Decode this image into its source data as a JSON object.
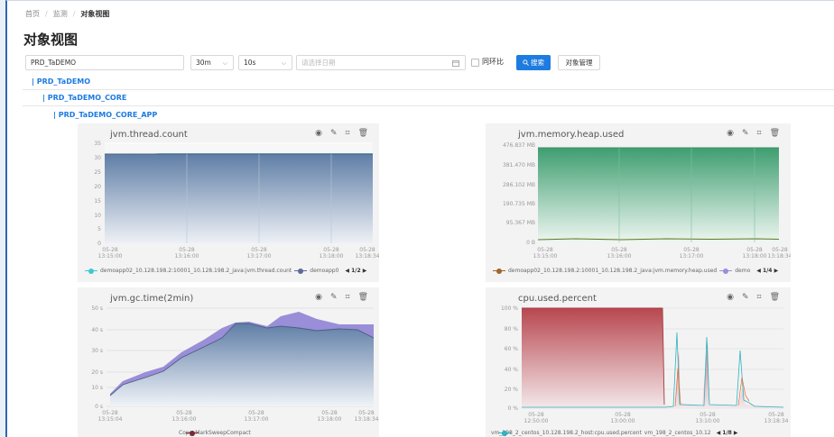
{
  "breadcrumb": {
    "items": [
      "首页",
      "监测",
      "对象视图"
    ]
  },
  "page": {
    "title": "对象视图"
  },
  "toolbar": {
    "object_value": "PRD_TaDEMO",
    "range_value": "30m",
    "interval_value": "10s",
    "date_placeholder": "请选择日期",
    "compare_label": "同环比",
    "search_label": "搜索",
    "manage_label": "对象管理"
  },
  "tree": {
    "items": [
      {
        "label": "| PRD_TaDEMO"
      },
      {
        "label": "| PRD_TaDEMO_CORE"
      },
      {
        "label": "| PRD_TaDEMO_CORE_APP"
      }
    ]
  },
  "colors": {
    "accent": "#1e7be0",
    "thread_fill": "#5f7ea6",
    "heap_fill": "#3e9e70",
    "gc_purple": "#9a8ed8",
    "cpu_red": "#b8474f"
  },
  "icons": [
    "eye-icon",
    "pencil-icon",
    "crop-icon",
    "trash-icon",
    "search-icon"
  ],
  "charts": {
    "thread": {
      "title": "jvm.thread.count",
      "legend": [
        "demoapp02_10.128.198.2:10001_10.128.198.2_java:jvm.thread.count",
        "demoapp0"
      ],
      "pager": "◀ 1/2 ▶"
    },
    "heap": {
      "title": "jvm.memory.heap.used",
      "legend": [
        "demoapp02_10.128.198.2:10001_10.128.198.2_java:jvm.memory.heap.used",
        "demo"
      ],
      "pager": "◀ 1/4 ▶"
    },
    "gc": {
      "title": "jvm.gc.time(2min)",
      "legend": [
        "Copy",
        "MarkSweepCompact"
      ]
    },
    "cpu": {
      "title": "cpu.used.percent",
      "legend": [
        "vm_198_2_centos_10.128.198.2_host:cpu.used.percent",
        "vm_198_2_centos_10.12"
      ],
      "pager": "◀ 1/8 ▶"
    }
  },
  "chart_data": [
    {
      "type": "area",
      "title": "jvm.thread.count",
      "x": [
        "13:15:00",
        "13:15:10",
        "13:15:20",
        "13:15:30",
        "13:15:40",
        "13:15:50",
        "13:16:00",
        "13:16:30",
        "13:17:00",
        "13:17:30",
        "13:18:00",
        "13:18:34"
      ],
      "x_tick_labels": [
        "05-28\n13:15:00",
        "05-28\n13:16:00",
        "05-28\n13:17:00",
        "05-28\n13:18:00",
        "05-28\n13:18:34"
      ],
      "series": [
        {
          "name": "demoapp02_10.128.198.2:10001_10.128.198.2_java:jvm.thread.count",
          "values": [
            30,
            30,
            30,
            30,
            30,
            31,
            31,
            31,
            31,
            31,
            31,
            31
          ]
        },
        {
          "name": "demoapp0",
          "values": [
            31,
            31,
            31,
            31,
            31,
            31,
            31,
            31,
            31,
            31,
            31,
            31
          ]
        }
      ],
      "y_ticks": [
        "0",
        "5",
        "10",
        "15",
        "20",
        "25",
        "30",
        "35"
      ],
      "ylim": [
        0,
        35
      ]
    },
    {
      "type": "area",
      "title": "jvm.memory.heap.used",
      "x": [
        "13:15:00",
        "13:16:00",
        "13:17:00",
        "13:18:00",
        "13:18:34"
      ],
      "x_tick_labels": [
        "05-28\n13:15:00",
        "05-28\n13:16:00",
        "05-28\n13:17:00",
        "05-28\n13:18:00",
        "05-28\n13:18:34"
      ],
      "series": [
        {
          "name": "demoapp02_10.128.198.2:10001_10.128.198.2_java:jvm.memory.heap.used",
          "values": [
            12,
            14,
            13,
            15,
            14
          ]
        },
        {
          "name": "demo",
          "values": [
            450,
            450,
            450,
            450,
            450
          ]
        }
      ],
      "y_ticks": [
        "0 B",
        "95.367 MB",
        "190.735 MB",
        "286.102 MB",
        "381.470 MB",
        "476.837 MB"
      ],
      "ylim": [
        0,
        476.837
      ]
    },
    {
      "type": "area",
      "title": "jvm.gc.time(2min)",
      "x": [
        "13:15:04",
        "13:15:20",
        "13:15:40",
        "13:16:00",
        "13:16:20",
        "13:16:40",
        "13:17:00",
        "13:17:20",
        "13:17:40",
        "13:18:00",
        "13:18:20",
        "13:18:34"
      ],
      "x_tick_labels": [
        "05-28\n13:15:04",
        "05-28\n13:16:00",
        "05-28\n13:17:00",
        "05-28\n13:18:00",
        "05-28\n13:18:34"
      ],
      "series": [
        {
          "name": "Copy",
          "values": [
            6,
            11,
            14,
            18,
            26,
            33,
            38,
            40,
            37,
            38,
            38,
            34
          ]
        },
        {
          "name": "MarkSweepCompact",
          "values": [
            7,
            14,
            17,
            21,
            29,
            36,
            42,
            43,
            45,
            47,
            42,
            41
          ]
        }
      ],
      "y_ticks": [
        "0 s",
        "10 s",
        "20 s",
        "30 s",
        "40 s",
        "50 s"
      ],
      "ylim": [
        0,
        50
      ]
    },
    {
      "type": "area",
      "title": "cpu.used.percent",
      "x": [
        "12:50:00",
        "12:55:00",
        "13:00:00",
        "13:03:00",
        "13:04:00",
        "13:06:00",
        "13:08:00",
        "13:10:00",
        "13:12:00",
        "13:15:00",
        "13:18:34"
      ],
      "x_tick_labels": [
        "05-28\n12:50:00",
        "05-28\n13:00:00",
        "05-28\n13:10:00",
        "05-28\n13:18:34"
      ],
      "series": [
        {
          "name": "vm_198_2_centos_10.128.198.2_host:cpu.used.percent",
          "values": [
            100,
            100,
            100,
            100,
            2,
            55,
            2,
            60,
            2,
            2,
            1
          ]
        },
        {
          "name": "vm_198_2_centos_10.12",
          "values": [
            1,
            1,
            1,
            1,
            2,
            40,
            2,
            45,
            2,
            35,
            1
          ]
        }
      ],
      "y_ticks": [
        "0 %",
        "20 %",
        "40 %",
        "60 %",
        "80 %",
        "100 %"
      ],
      "ylim": [
        0,
        100
      ]
    }
  ]
}
